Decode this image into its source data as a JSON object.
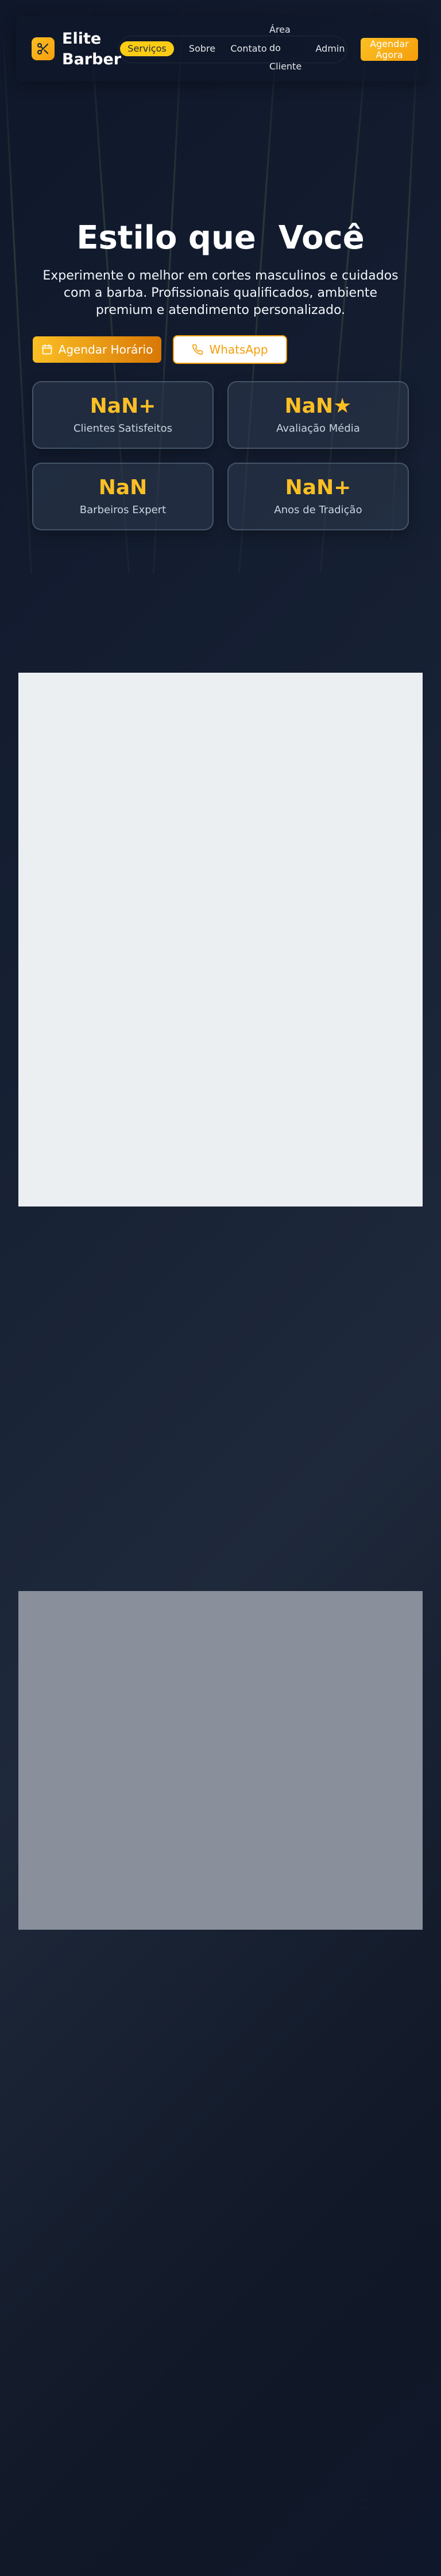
{
  "brand": {
    "name": "Elite Barber",
    "logo_icon": "scissors-icon",
    "accent": "#f59e0b"
  },
  "nav": {
    "links": [
      {
        "label": "Serviços",
        "active": true
      },
      {
        "label": "Sobre"
      },
      {
        "label": "Contato"
      },
      {
        "label": "Área do Cliente"
      },
      {
        "label": "Admin"
      }
    ],
    "cta": "Agendar Agora"
  },
  "hero": {
    "title": "Estilo que  Você",
    "subtitle": "Experimente o melhor em cortes masculinos e cuidados com a barba. Profissionais qualificados, ambiente premium e atendimento personalizado.",
    "primary_button": {
      "label": "Agendar Horário",
      "icon": "calendar-icon"
    },
    "secondary_button": {
      "label": "WhatsApp",
      "icon": "phone-icon"
    }
  },
  "stats": [
    {
      "value": "NaN+",
      "label": "Clientes Satisfeitos"
    },
    {
      "value": "NaN★",
      "label": "Avaliação Média"
    },
    {
      "value": "NaN",
      "label": "Barbeiros Expert"
    },
    {
      "value": "NaN+",
      "label": "Anos de Tradição"
    }
  ]
}
